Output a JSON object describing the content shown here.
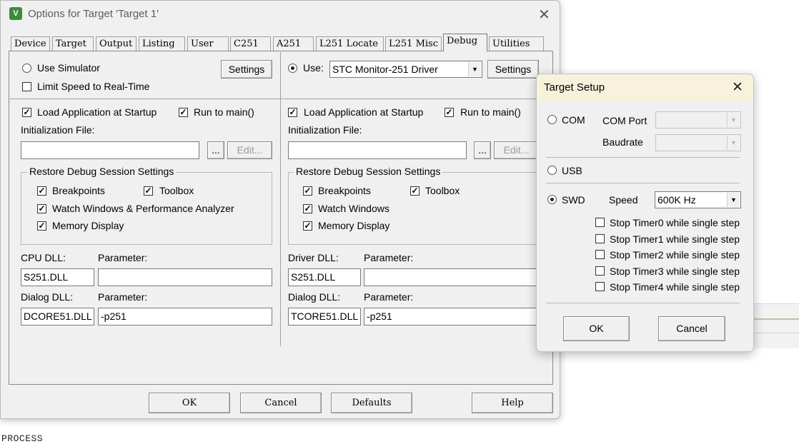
{
  "background": {
    "process_text": "PROCESS"
  },
  "main_dialog": {
    "title": "Options for Target 'Target 1'",
    "logo_text": "V",
    "close_glyph": "✕",
    "tabs": [
      "Device",
      "Target",
      "Output",
      "Listing",
      "User",
      "C251",
      "A251",
      "L251 Locate",
      "L251 Misc",
      "Debug",
      "Utilities"
    ],
    "active_tab": "Debug",
    "left": {
      "use_simulator": "Use Simulator",
      "settings": "Settings",
      "limit_speed": "Limit Speed to Real-Time",
      "load_app": "Load Application at Startup",
      "run_to_main": "Run to main()",
      "init_file_label": "Initialization File:",
      "init_file_value": "",
      "browse": "...",
      "edit": "Edit...",
      "restore_group": "Restore Debug Session Settings",
      "breakpoints": "Breakpoints",
      "toolbox": "Toolbox",
      "watch": "Watch Windows & Performance Analyzer",
      "memory": "Memory Display",
      "cpu_dll_label": "CPU DLL:",
      "parameter_label": "Parameter:",
      "cpu_dll_value": "S251.DLL",
      "cpu_param_value": "",
      "dialog_dll_label": "Dialog DLL:",
      "dialog_param_label": "Parameter:",
      "dialog_dll_value": "DCORE51.DLL",
      "dialog_param_value": "-p251"
    },
    "right": {
      "use_label": "Use:",
      "driver": "STC Monitor-251 Driver",
      "settings": "Settings",
      "load_app": "Load Application at Startup",
      "run_to_main": "Run to main()",
      "init_file_label": "Initialization File:",
      "init_file_value": "",
      "browse": "...",
      "edit": "Edit...",
      "restore_group": "Restore Debug Session Settings",
      "breakpoints": "Breakpoints",
      "toolbox": "Toolbox",
      "watch": "Watch Windows",
      "memory": "Memory Display",
      "driver_dll_label": "Driver DLL:",
      "parameter_label": "Parameter:",
      "driver_dll_value": "S251.DLL",
      "driver_param_value": "",
      "dialog_dll_label": "Dialog DLL:",
      "dialog_param_label": "Parameter:",
      "dialog_dll_value": "TCORE51.DLL",
      "dialog_param_value": "-p251"
    },
    "buttons": {
      "ok": "OK",
      "cancel": "Cancel",
      "defaults": "Defaults",
      "help": "Help"
    }
  },
  "target_setup": {
    "title": "Target Setup",
    "close_glyph": "✕",
    "com": "COM",
    "com_port_label": "COM Port",
    "com_port_value": "",
    "baudrate_label": "Baudrate",
    "baudrate_value": "",
    "usb": "USB",
    "swd": "SWD",
    "speed_label": "Speed",
    "speed_value": "600K Hz",
    "stop_timers": [
      "Stop Timer0 while single step",
      "Stop Timer1 while single step",
      "Stop Timer2 while single step",
      "Stop Timer3 while single step",
      "Stop Timer4 while single step"
    ],
    "ok": "OK",
    "cancel": "Cancel"
  },
  "glyphs": {
    "check": "✓",
    "dropdown_arrow": "▼"
  },
  "colors": {
    "setup_titlebar": "#f8f1dc",
    "logo": "#3c8c3a"
  }
}
